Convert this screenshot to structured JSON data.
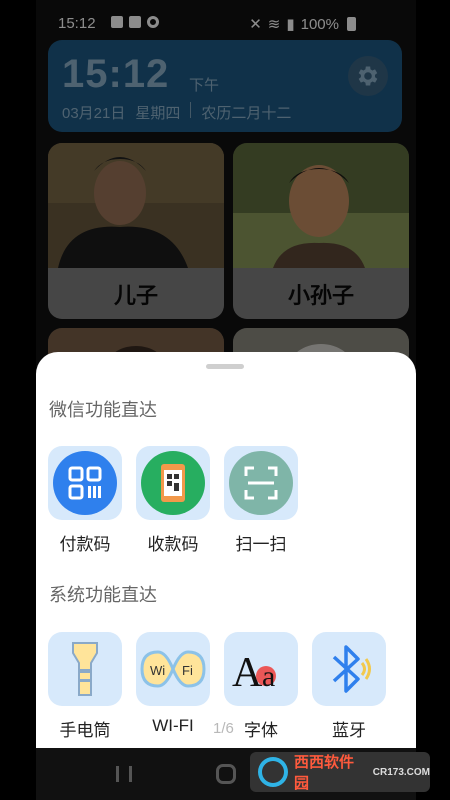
{
  "status_bar": {
    "time": "15:12",
    "battery": "100%"
  },
  "clock": {
    "time": "15:12",
    "ampm": "下午",
    "date": "03月21日",
    "weekday": "星期四",
    "lunar": "农历二月十二"
  },
  "contacts": [
    {
      "name": "儿子"
    },
    {
      "name": "小孙子"
    }
  ],
  "sheet": {
    "wechat_title": "微信功能直达",
    "wechat_items": [
      {
        "label": "付款码",
        "icon": "payment-code-icon"
      },
      {
        "label": "收款码",
        "icon": "receive-code-icon"
      },
      {
        "label": "扫一扫",
        "icon": "scan-icon"
      }
    ],
    "system_title": "系统功能直达",
    "system_items": [
      {
        "label": "手电筒",
        "icon": "flashlight-icon"
      },
      {
        "label": "WI-FI",
        "icon": "wifi-icon"
      },
      {
        "label": "字体",
        "icon": "font-icon"
      },
      {
        "label": "蓝牙",
        "icon": "bluetooth-icon"
      }
    ],
    "pager": "1/6"
  },
  "watermark": {
    "brand": "西西软件园",
    "url": "CR173.COM"
  },
  "colors": {
    "clock_card": "#1e5a86",
    "tile_bg": "#d7e9fb",
    "payment_blue": "#2f80ed",
    "receive_green": "#27ae60",
    "scan_teal": "#7fb5a8"
  }
}
